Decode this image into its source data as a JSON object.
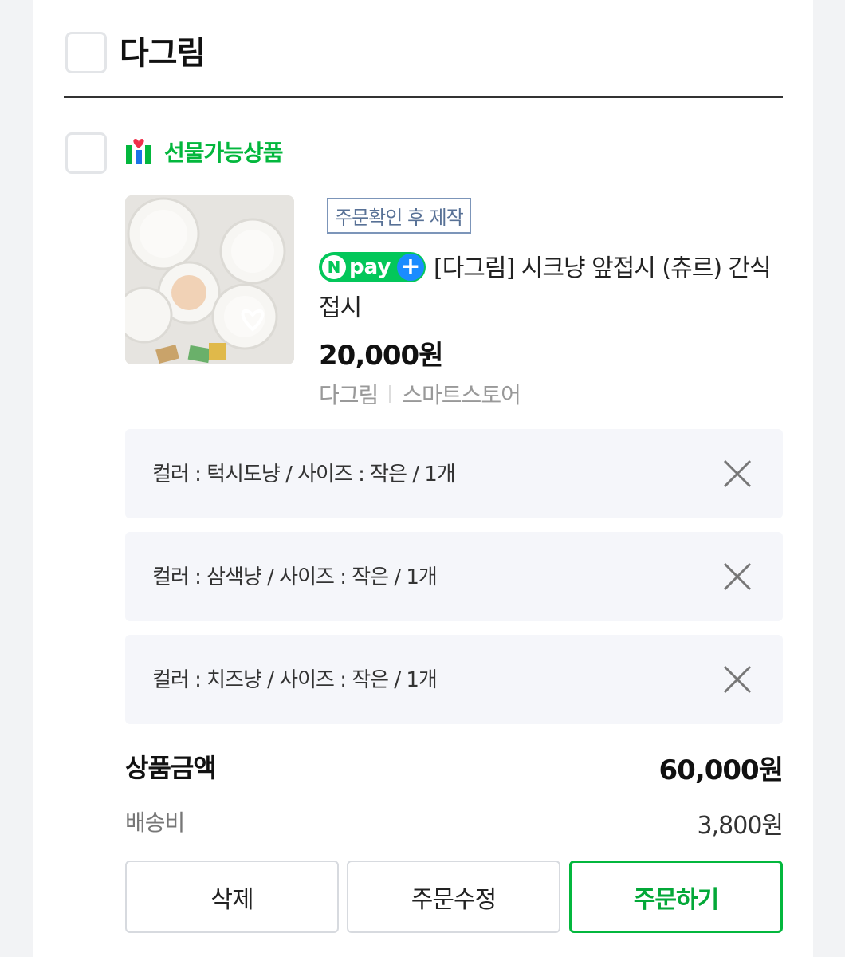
{
  "store": {
    "name": "다그림"
  },
  "gift": {
    "label": "선물가능상품"
  },
  "product": {
    "tag": "주문확인 후 제작",
    "npay": {
      "n": "N",
      "pay": "pay",
      "plus": "+"
    },
    "name": "[다그림] 시크냥 앞접시 (츄르) 간식 접시",
    "price": "20,000원",
    "seller": "다그림",
    "channel": "스마트스토어"
  },
  "options": [
    {
      "label": "컬러 : 턱시도냥 / 사이즈 : 작은 / 1개"
    },
    {
      "label": "컬러 : 삼색냥 / 사이즈 : 작은 / 1개"
    },
    {
      "label": "컬러 : 치즈냥 / 사이즈 : 작은 / 1개"
    }
  ],
  "summary": {
    "product_amount_label": "상품금액",
    "product_amount": "60,000원",
    "shipping_label": "배송비",
    "shipping": "3,800원"
  },
  "buttons": {
    "delete": "삭제",
    "edit_order": "주문수정",
    "order": "주문하기"
  },
  "colors": {
    "accent": "#03b73d",
    "npay": "#03c75a",
    "tag_border": "#7c95b9"
  }
}
